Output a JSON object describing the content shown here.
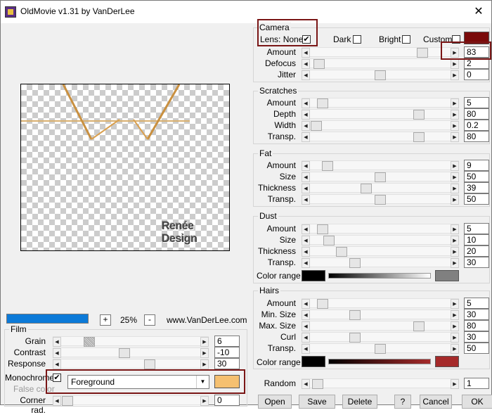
{
  "title": "OldMovie v1.31 by VanDerLee",
  "close_glyph": "✕",
  "preview": {
    "watermark": "Renée Design"
  },
  "bottom": {
    "zoom_minus": "-",
    "zoom_plus": "+",
    "zoom": "25%",
    "url": "www.VanDerLee.com",
    "progress": 1.0
  },
  "camera": {
    "title": "Camera",
    "lens_label": "Lens: None",
    "lens_checked": true,
    "dark_label": "Dark",
    "bright_label": "Bright",
    "custom_label": "Custom",
    "custom_color": "#7a0a0a",
    "rows": [
      {
        "label": "Amount",
        "value": "83",
        "pos": 0.83
      },
      {
        "label": "Defocus",
        "value": "2",
        "pos": 0.02
      },
      {
        "label": "Jitter",
        "value": "0",
        "pos": 0.5
      }
    ]
  },
  "scratches": {
    "title": "Scratches",
    "rows": [
      {
        "label": "Amount",
        "value": "5",
        "pos": 0.05
      },
      {
        "label": "Depth",
        "value": "80",
        "pos": 0.8
      },
      {
        "label": "Width",
        "value": "0.2",
        "pos": 0.0
      },
      {
        "label": "Transp.",
        "value": "80",
        "pos": 0.8
      }
    ]
  },
  "fat": {
    "title": "Fat",
    "rows": [
      {
        "label": "Amount",
        "value": "9",
        "pos": 0.09
      },
      {
        "label": "Size",
        "value": "50",
        "pos": 0.5
      },
      {
        "label": "Thickness",
        "value": "39",
        "pos": 0.39
      },
      {
        "label": "Transp.",
        "value": "50",
        "pos": 0.5
      }
    ]
  },
  "dust": {
    "title": "Dust",
    "rows": [
      {
        "label": "Amount",
        "value": "5",
        "pos": 0.05
      },
      {
        "label": "Size",
        "value": "10",
        "pos": 0.1
      },
      {
        "label": "Thickness",
        "value": "20",
        "pos": 0.2
      },
      {
        "label": "Transp.",
        "value": "30",
        "pos": 0.3
      }
    ],
    "color_range_label": "Color range",
    "color_start": "#000000",
    "color_end": "#808080"
  },
  "hairs": {
    "title": "Hairs",
    "rows": [
      {
        "label": "Amount",
        "value": "5",
        "pos": 0.05
      },
      {
        "label": "Min. Size",
        "value": "30",
        "pos": 0.3
      },
      {
        "label": "Max. Size",
        "value": "80",
        "pos": 0.8
      },
      {
        "label": "Curl",
        "value": "30",
        "pos": 0.3
      },
      {
        "label": "Transp.",
        "value": "50",
        "pos": 0.5
      }
    ],
    "color_range_label": "Color range",
    "color_start": "#000000",
    "color_end": "#a52a2a"
  },
  "random": {
    "label": "Random",
    "value": "1",
    "pos": 0.01
  },
  "film": {
    "title": "Film",
    "rows": [
      {
        "label": "Grain",
        "value": "6",
        "pos": 0.17
      },
      {
        "label": "Contrast",
        "value": "-10",
        "pos": 0.45
      },
      {
        "label": "Response",
        "value": "30",
        "pos": 0.65
      }
    ],
    "mono_label": "Monochrome",
    "mono_checked": true,
    "false_color_label": "False color",
    "mono_select": "Foreground",
    "mono_color": "#f5c070",
    "corner_label": "Corner rad.",
    "corner_value": "0",
    "corner_pos": 0.0
  },
  "buttons": {
    "open": "Open",
    "save": "Save",
    "delete": "Delete",
    "help": "?",
    "cancel": "Cancel",
    "ok": "OK"
  }
}
